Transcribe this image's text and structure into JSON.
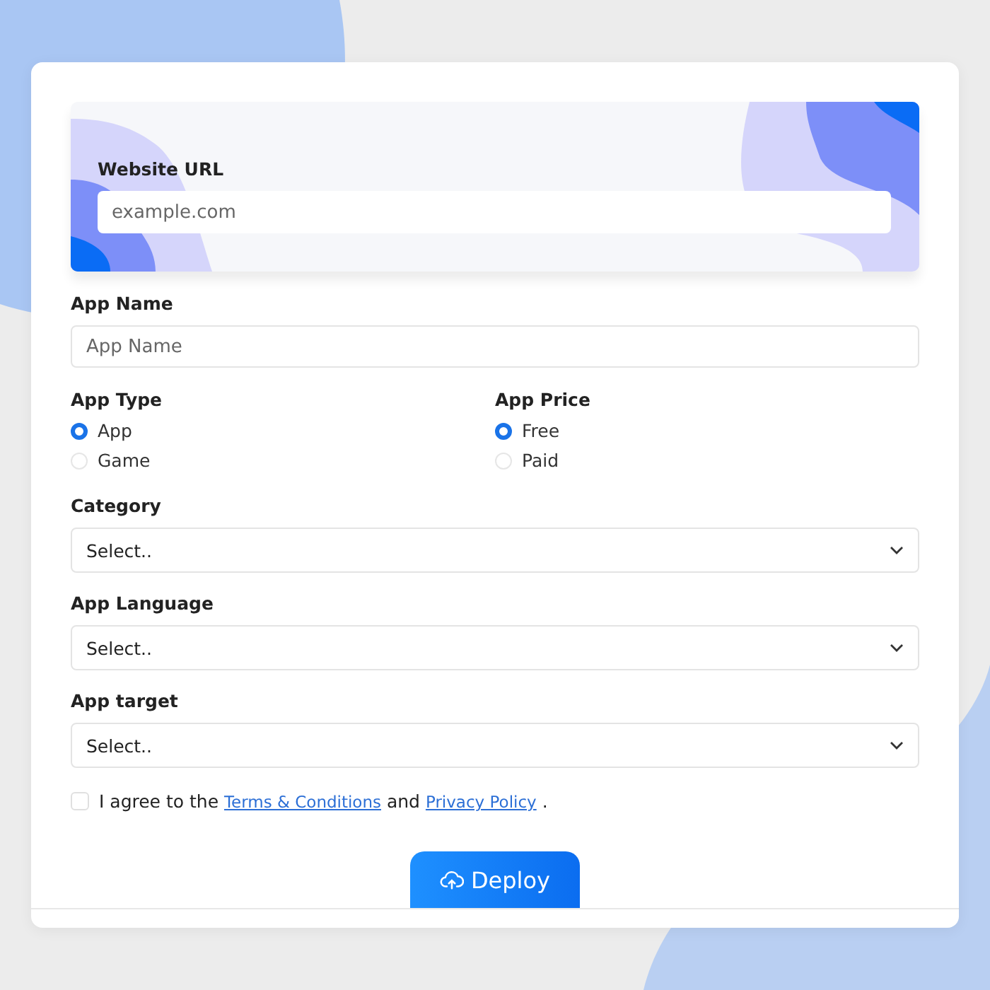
{
  "website_url": {
    "label": "Website URL",
    "placeholder": "example.com"
  },
  "app_name": {
    "label": "App Name",
    "placeholder": "App Name"
  },
  "radio_groups": [
    {
      "label": "App Type",
      "options": [
        {
          "label": "App",
          "selected": true
        },
        {
          "label": "Game",
          "selected": false
        }
      ]
    },
    {
      "label": "App Price",
      "options": [
        {
          "label": "Free",
          "selected": true
        },
        {
          "label": "Paid",
          "selected": false
        }
      ]
    }
  ],
  "selects": [
    {
      "label": "Category",
      "value": "Select.."
    },
    {
      "label": "App Language",
      "value": "Select.."
    },
    {
      "label": "App target",
      "value": "Select.."
    }
  ],
  "agreement": {
    "checked": false,
    "text_before": "I agree to the",
    "terms_link": "Terms & Conditions",
    "text_middle": "and",
    "privacy_link": "Privacy Policy",
    "text_end": "."
  },
  "deploy_button": {
    "label": "Deploy"
  }
}
